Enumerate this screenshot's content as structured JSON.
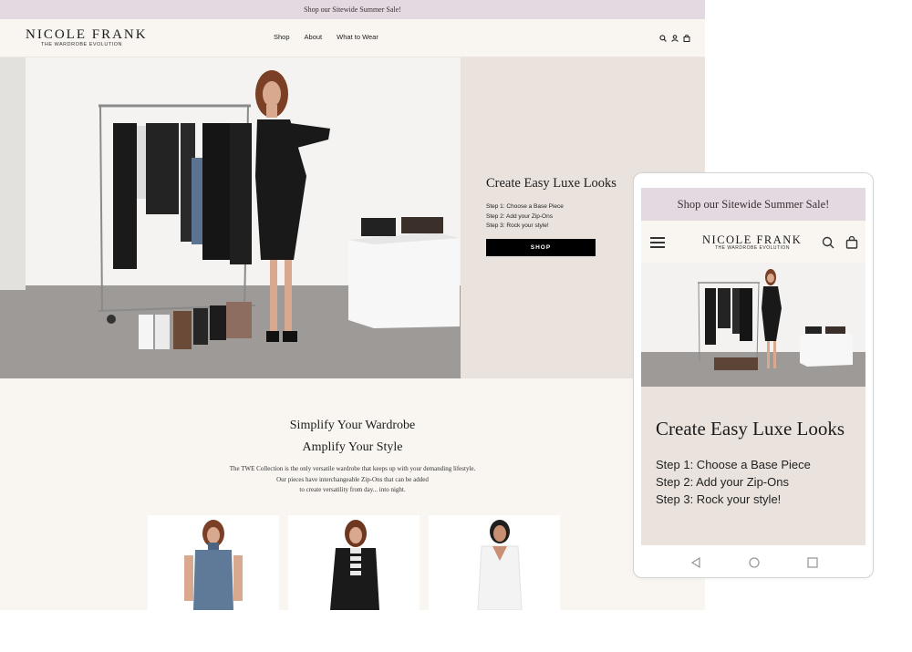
{
  "desktop": {
    "announcement": "Shop our Sitewide Summer Sale!",
    "brand": {
      "name": "NICOLE FRANK",
      "tagline": "THE WARDROBE EVOLUTION"
    },
    "nav": {
      "links": [
        "Shop",
        "About",
        "What to Wear"
      ]
    },
    "icons": [
      "search-icon",
      "account-icon",
      "bag-icon"
    ],
    "hero": {
      "title": "Create Easy Luxe Looks",
      "steps": [
        "Step 1: Choose a Base Piece",
        "Step 2: Add your Zip-Ons",
        "Step 3: Rock your style!"
      ],
      "button": "SHOP"
    },
    "intro": {
      "heading_line1": "Simplify Your Wardrobe",
      "heading_line2": "Amplify Your Style",
      "paragraph": [
        "The TWE Collection is the only versatile wardrobe that keeps up with your demanding lifestyle.",
        "Our pieces have interchangeable Zip-Ons that can be added",
        "to create versatility from day... into night."
      ]
    }
  },
  "mobile": {
    "announcement": "Shop our Sitewide Summer Sale!",
    "brand": {
      "name": "NICOLE FRANK",
      "tagline": "THE WARDROBE EVOLUTION"
    },
    "hero": {
      "title": "Create Easy Luxe Looks",
      "steps": [
        "Step 1: Choose a Base Piece",
        "Step 2: Add your Zip-Ons",
        "Step 3: Rock your style!"
      ]
    },
    "system_nav": [
      "back-icon",
      "home-icon",
      "recents-icon"
    ]
  },
  "colors": {
    "announcement_bg": "#e3d9e0",
    "page_bg": "#f9f6f1",
    "hero_bg": "#eae3dd",
    "button_bg": "#000000"
  }
}
